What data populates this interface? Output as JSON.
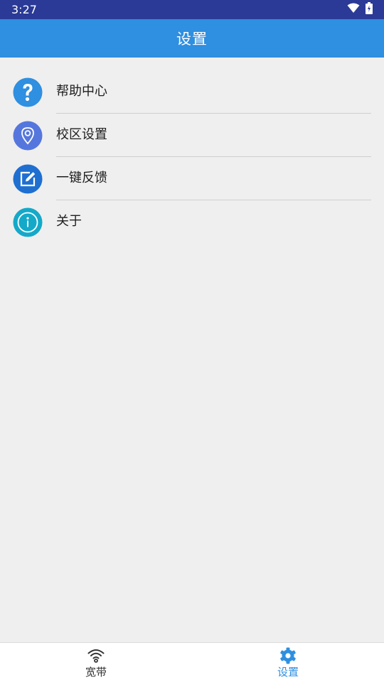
{
  "status_bar": {
    "time": "3:27",
    "icons": [
      "wifi-icon",
      "battery-icon"
    ]
  },
  "app_bar": {
    "title": "设置"
  },
  "settings": {
    "items": [
      {
        "label": "帮助中心",
        "icon": "help-icon",
        "color": "#2f8fe0"
      },
      {
        "label": "校区设置",
        "icon": "location-pin-icon",
        "color": "#5577dd"
      },
      {
        "label": "一键反馈",
        "icon": "edit-feedback-icon",
        "color": "#1f6fd0"
      },
      {
        "label": "关于",
        "icon": "info-icon",
        "color": "#14a9c9"
      }
    ]
  },
  "bottom_nav": {
    "tabs": [
      {
        "label": "宽带",
        "icon": "wifi-icon",
        "active": false
      },
      {
        "label": "设置",
        "icon": "gear-icon",
        "active": true
      }
    ],
    "active_color": "#2f8fe0",
    "inactive_color": "#333333"
  },
  "colors": {
    "status_bar": "#2a3a96",
    "app_bar": "#2f8fe0",
    "background": "#efefef"
  }
}
